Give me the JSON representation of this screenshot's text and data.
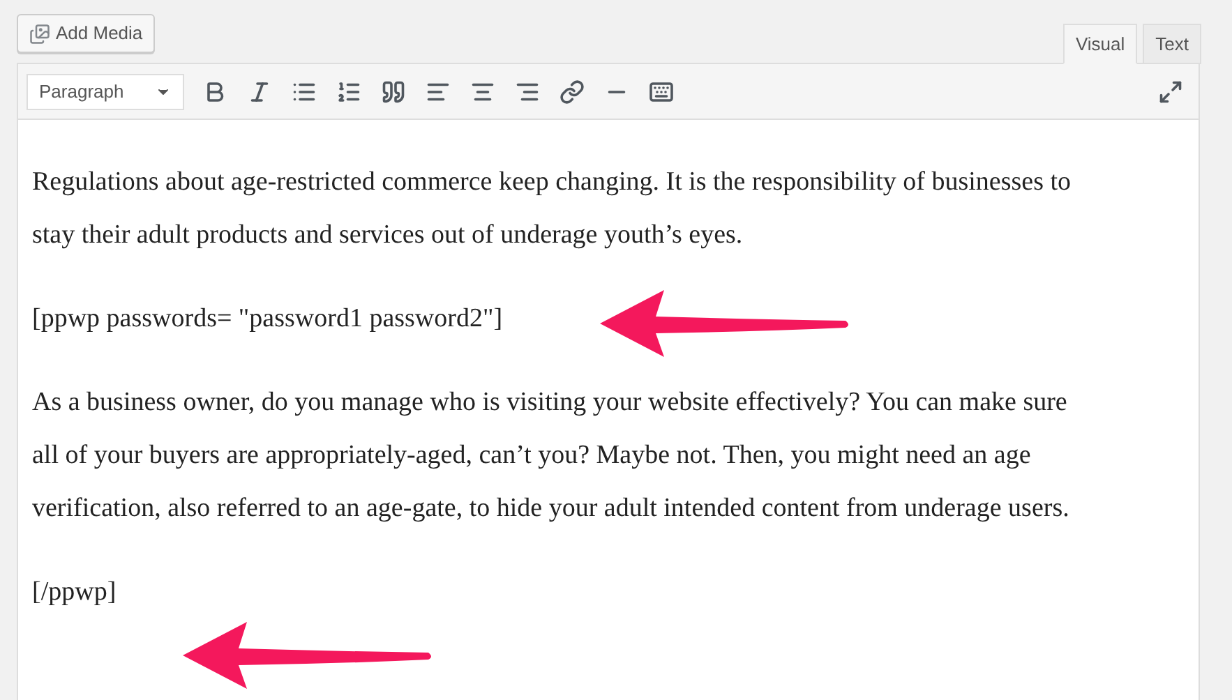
{
  "add_media_button": {
    "label": "Add Media"
  },
  "tabs": [
    {
      "label": "Visual",
      "selected": true
    },
    {
      "label": "Text",
      "selected": false
    }
  ],
  "format_select": {
    "value": "Paragraph"
  },
  "content": {
    "paragraphs": [
      "Regulations about age-restricted commerce keep changing. It is the responsibility of businesses to stay their adult products and services out of underage youth’s eyes.",
      "[ppwp passwords= \"password1 password2\"]",
      "As a business owner, do you manage who is visiting your website effectively? You can make sure all of your buyers are appropriately-aged, can’t you? Maybe not. Then, you might need an age verification, also referred to an age-gate, to hide your adult intended content from underage users.",
      "[/ppwp]"
    ]
  }
}
